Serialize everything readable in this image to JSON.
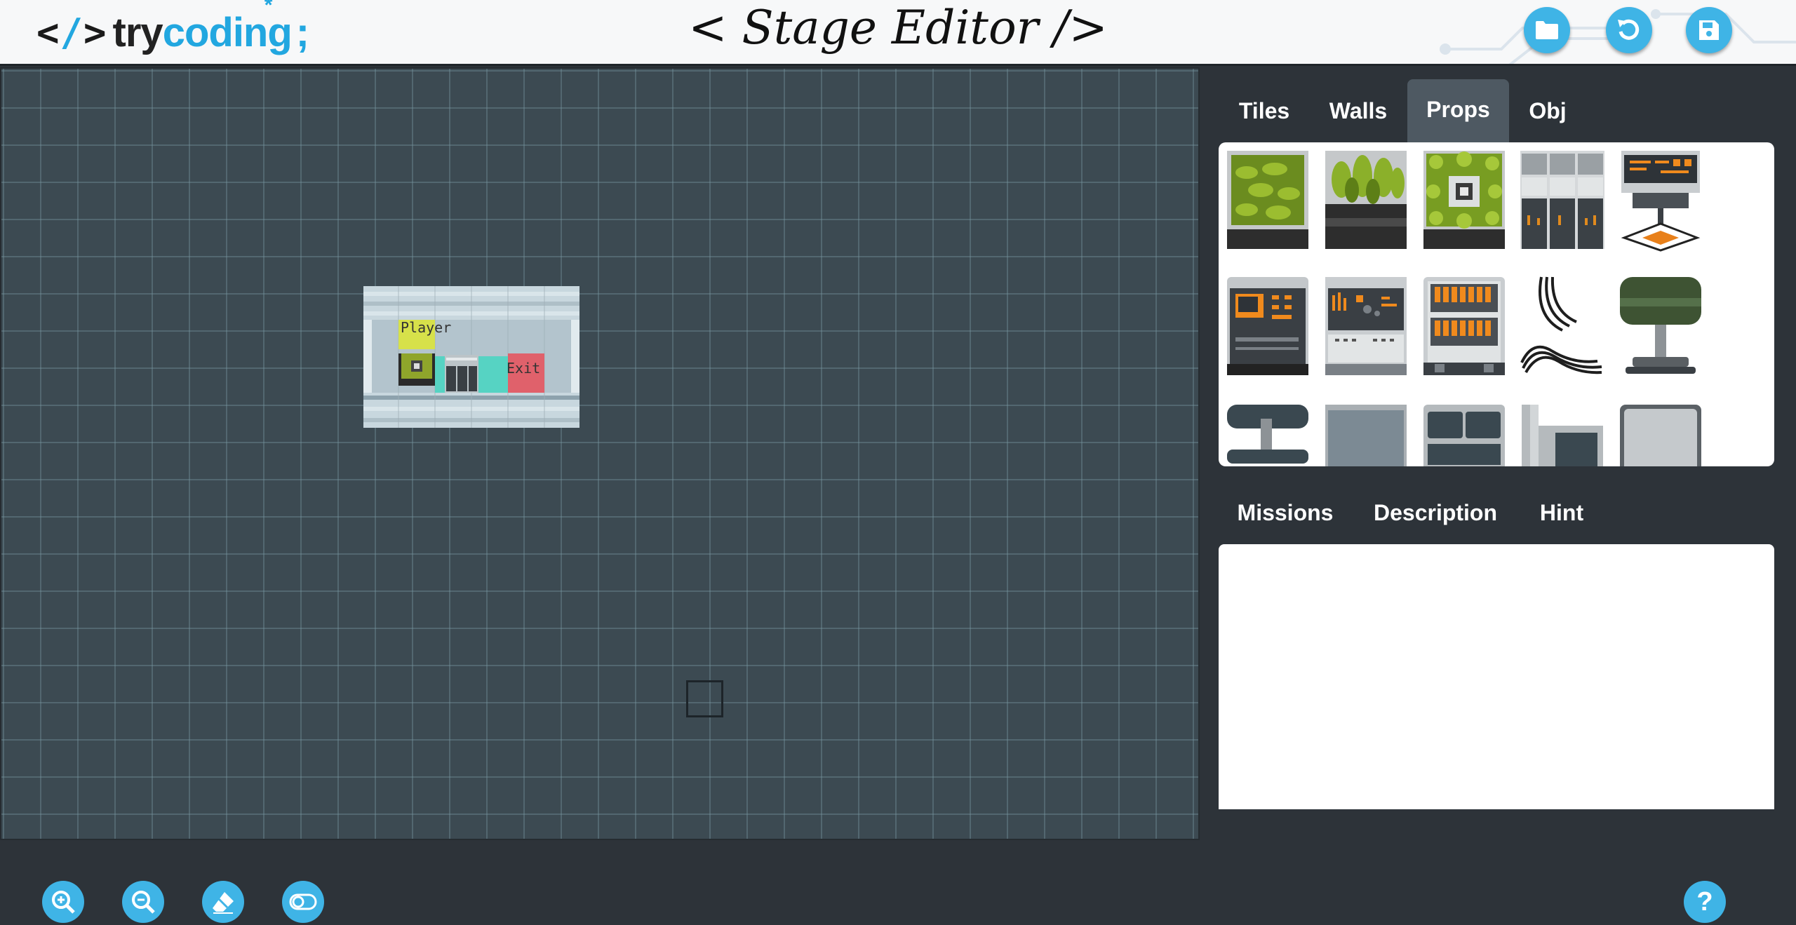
{
  "header": {
    "logo": {
      "bracket_open": "<",
      "slash": "/",
      "bracket_close": ">",
      "brand_try": "try",
      "brand_coding": "coding",
      "semicolon": ";"
    },
    "title": "< Stage Editor />",
    "buttons": [
      {
        "name": "open-folder-button",
        "icon": "folder-icon"
      },
      {
        "name": "undo-button",
        "icon": "undo-icon"
      },
      {
        "name": "save-button",
        "icon": "floppy-icon"
      }
    ]
  },
  "canvas": {
    "room": {
      "player_label": "Player",
      "exit_label": "Exit"
    }
  },
  "palette": {
    "tabs": [
      "Tiles",
      "Walls",
      "Props",
      "Obj"
    ],
    "active_tab": "Props",
    "items": [
      "hedge-planter",
      "tall-plant-planter",
      "plant-ring-planter",
      "server-rack",
      "computer-terminal",
      "control-console",
      "lab-machine",
      "server-cabinet",
      "cable-bundle",
      "round-table-green",
      "round-table-dark",
      "steel-counter",
      "double-cabinet",
      "corner-desk",
      "display-case"
    ]
  },
  "info": {
    "tabs": [
      "Missions",
      "Description",
      "Hint"
    ],
    "content": ""
  },
  "tools": [
    {
      "name": "zoom-in-button",
      "icon": "zoom-in-icon"
    },
    {
      "name": "zoom-out-button",
      "icon": "zoom-out-icon"
    },
    {
      "name": "eraser-button",
      "icon": "eraser-icon"
    },
    {
      "name": "toggle-button",
      "icon": "toggle-icon"
    }
  ],
  "help": {
    "icon": "question-icon",
    "label": "?"
  },
  "colors": {
    "accent": "#3fb4e6",
    "canvas": "#3c4a52",
    "panel": "#2d3339",
    "exit": "#e0616b",
    "player": "#d7e14a",
    "floor": "#56d3c3"
  }
}
